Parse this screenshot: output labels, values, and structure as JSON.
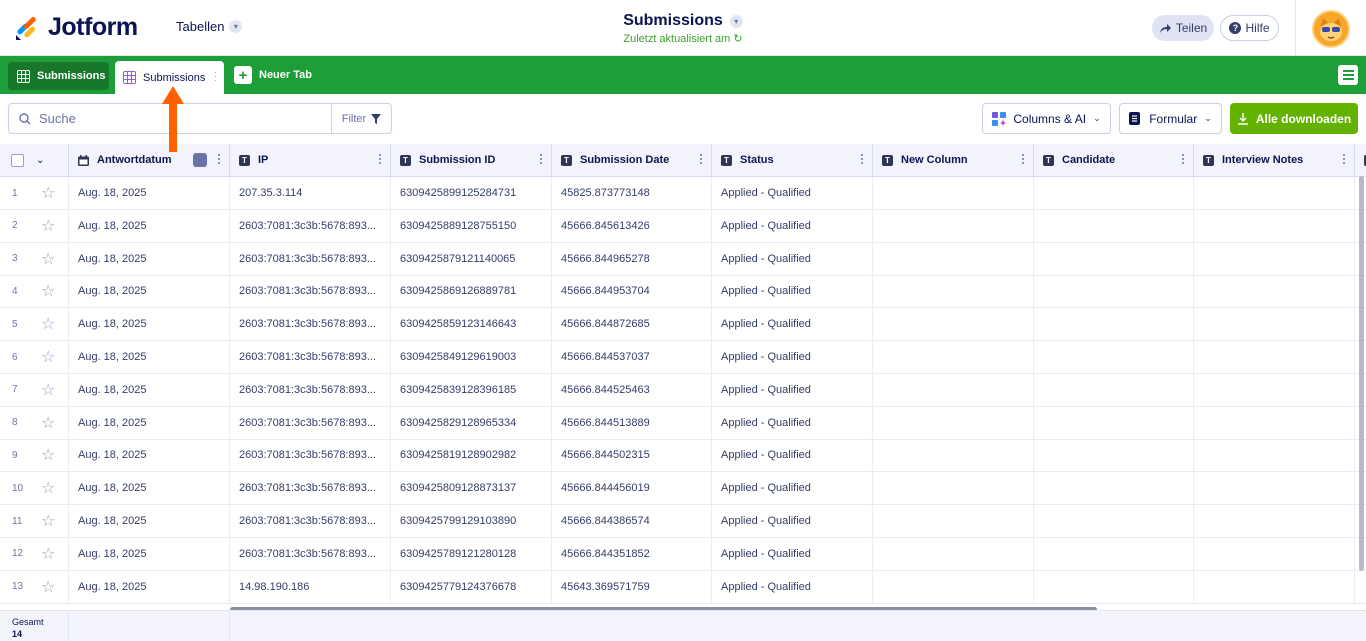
{
  "header": {
    "brand": "Jotform",
    "workspace": "Tabellen",
    "title": "Submissions",
    "subtitle": "Zuletzt aktualisiert am",
    "share_label": "Teilen",
    "help_label": "Hilfe"
  },
  "tabbar": {
    "tabs": [
      {
        "label": "Submissions"
      },
      {
        "label": "Submissions"
      }
    ],
    "new_tab_label": "Neuer Tab"
  },
  "toolbar": {
    "search_placeholder": "Suche",
    "filter_label": "Filter",
    "columns_label": "Columns & AI",
    "form_label": "Formular",
    "download_label": "Alle downloaden"
  },
  "table": {
    "columns": [
      "Antwortdatum",
      "IP",
      "Submission ID",
      "Submission Date",
      "Status",
      "New Column",
      "Candidate",
      "Interview Notes"
    ],
    "rows": [
      {
        "n": "1",
        "date": "Aug. 18, 2025",
        "ip": "207.35.3.114",
        "sid": "6309425899125284731",
        "sdate": "45825.873773148",
        "status": "Applied - Qualified"
      },
      {
        "n": "2",
        "date": "Aug. 18, 2025",
        "ip": "2603:7081:3c3b:5678:893...",
        "sid": "6309425889128755150",
        "sdate": "45666.845613426",
        "status": "Applied - Qualified"
      },
      {
        "n": "3",
        "date": "Aug. 18, 2025",
        "ip": "2603:7081:3c3b:5678:893...",
        "sid": "6309425879121140065",
        "sdate": "45666.844965278",
        "status": "Applied - Qualified"
      },
      {
        "n": "4",
        "date": "Aug. 18, 2025",
        "ip": "2603:7081:3c3b:5678:893...",
        "sid": "6309425869126889781",
        "sdate": "45666.844953704",
        "status": "Applied - Qualified"
      },
      {
        "n": "5",
        "date": "Aug. 18, 2025",
        "ip": "2603:7081:3c3b:5678:893...",
        "sid": "6309425859123146643",
        "sdate": "45666.844872685",
        "status": "Applied - Qualified"
      },
      {
        "n": "6",
        "date": "Aug. 18, 2025",
        "ip": "2603:7081:3c3b:5678:893...",
        "sid": "6309425849129619003",
        "sdate": "45666.844537037",
        "status": "Applied - Qualified"
      },
      {
        "n": "7",
        "date": "Aug. 18, 2025",
        "ip": "2603:7081:3c3b:5678:893...",
        "sid": "6309425839128396185",
        "sdate": "45666.844525463",
        "status": "Applied - Qualified"
      },
      {
        "n": "8",
        "date": "Aug. 18, 2025",
        "ip": "2603:7081:3c3b:5678:893...",
        "sid": "6309425829128965334",
        "sdate": "45666.844513889",
        "status": "Applied - Qualified"
      },
      {
        "n": "9",
        "date": "Aug. 18, 2025",
        "ip": "2603:7081:3c3b:5678:893...",
        "sid": "6309425819128902982",
        "sdate": "45666.844502315",
        "status": "Applied - Qualified"
      },
      {
        "n": "10",
        "date": "Aug. 18, 2025",
        "ip": "2603:7081:3c3b:5678:893...",
        "sid": "6309425809128873137",
        "sdate": "45666.844456019",
        "status": "Applied - Qualified"
      },
      {
        "n": "11",
        "date": "Aug. 18, 2025",
        "ip": "2603:7081:3c3b:5678:893...",
        "sid": "6309425799129103890",
        "sdate": "45666.844386574",
        "status": "Applied - Qualified"
      },
      {
        "n": "12",
        "date": "Aug. 18, 2025",
        "ip": "2603:7081:3c3b:5678:893...",
        "sid": "6309425789121280128",
        "sdate": "45666.844351852",
        "status": "Applied - Qualified"
      },
      {
        "n": "13",
        "date": "Aug. 18, 2025",
        "ip": "14.98.190.186",
        "sid": "6309425779124376678",
        "sdate": "45643.369571759",
        "status": "Applied - Qualified"
      }
    ]
  },
  "footer": {
    "total_label": "Gesamt",
    "total_count": "14"
  },
  "colors": {
    "brand_green": "#1e9e38",
    "dark_green": "#17772b",
    "download_green": "#64b200",
    "navy": "#0a1551",
    "annotation_arrow": "#ff6100"
  }
}
